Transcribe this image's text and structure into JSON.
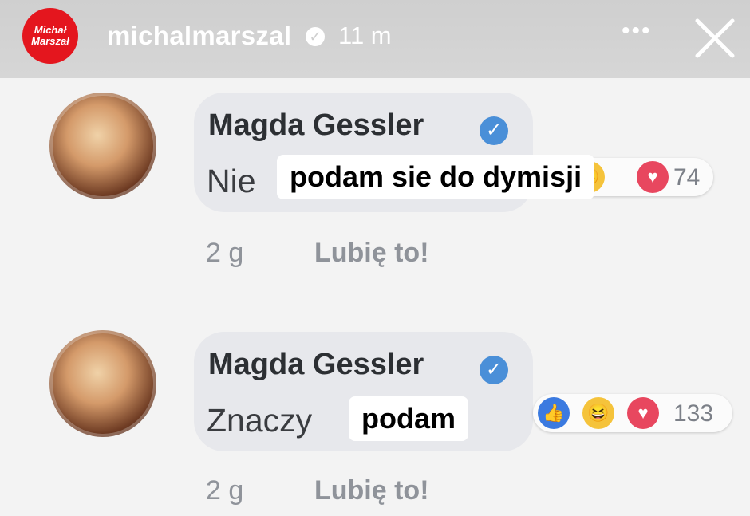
{
  "story": {
    "logo_line1": "Michał",
    "logo_line2": "Marszał",
    "username": "michalmarszal",
    "time": "11 m",
    "more": "•••"
  },
  "comments": [
    {
      "author": "Magda Gessler",
      "text": "Nie",
      "sticker": "podam sie do dymisji",
      "reaction_count": "74",
      "age": "2 g",
      "like_label": "Lubię to!"
    },
    {
      "author": "Magda Gessler",
      "text": "Znaczy",
      "sticker": "podam",
      "reaction_count": "133",
      "age": "2 g",
      "like_label": "Lubię to!"
    }
  ],
  "icons": {
    "verified": "verified-badge-icon",
    "close": "close-icon",
    "more": "more-options-icon",
    "like": "like-reaction-icon",
    "haha": "haha-reaction-icon",
    "love": "love-reaction-icon"
  },
  "colors": {
    "header": "#d2d2d2",
    "logo": "#e4161e",
    "verified_blue": "#4a8fd8",
    "bubble": "#e7e8ec"
  }
}
